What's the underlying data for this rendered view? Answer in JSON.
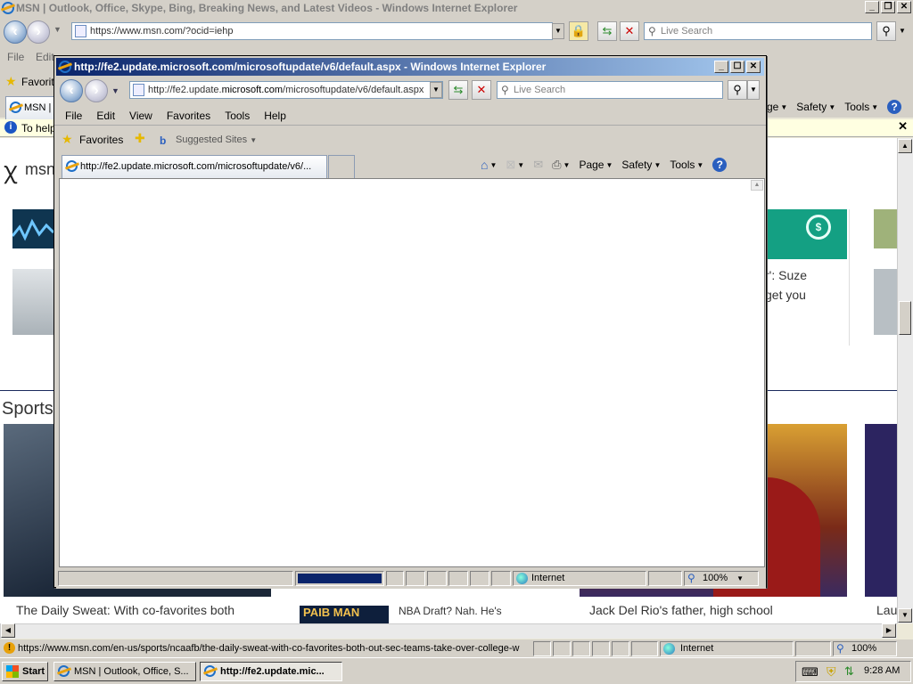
{
  "main_window": {
    "title": "MSN | Outlook, Office, Skype, Bing, Breaking News, and Latest Videos - Windows Internet Explorer",
    "address": "https://www.msn.com/?ocid=iehp",
    "search_placeholder": "Live Search",
    "menu": [
      "File",
      "Edit"
    ],
    "favorites_label": "Favorite",
    "tab_label": "MSN | C",
    "cmd_items": [
      "ge",
      "Safety",
      "Tools"
    ],
    "info_bar_text": "To help",
    "logo_text": "msn",
    "sports_heading": "Sports",
    "headlines": {
      "right_snippet_1": "r': Suze",
      "right_snippet_2": "get you",
      "sports_1": "The Daily Sweat: With co-favorites both",
      "sports_2": "NBA Draft? Nah. He's",
      "sports_2_img_text": "PAIB MAN",
      "sports_3": "Jack Del Rio's father, high school",
      "sports_4": "Lau"
    },
    "status_url": "https://www.msn.com/en-us/sports/ncaafb/the-daily-sweat-with-co-favorites-both-out-sec-teams-take-over-college-w",
    "status_zone": "Internet",
    "status_zoom": "100%"
  },
  "popup_window": {
    "title": "http://fe2.update.microsoft.com/microsoftupdate/v6/default.aspx - Windows Internet Explorer",
    "address_pre": "http://fe2.update.",
    "address_bold": "microsoft.com",
    "address_post": "/microsoftupdate/v6/default.aspx",
    "search_placeholder": "Live Search",
    "menu": [
      "File",
      "Edit",
      "View",
      "Favorites",
      "Tools",
      "Help"
    ],
    "favorites_label": "Favorites",
    "suggested_sites": "Suggested Sites",
    "tab_label": "http://fe2.update.microsoft.com/microsoftupdate/v6/...",
    "cmd_items": [
      "Page",
      "Safety",
      "Tools"
    ],
    "status_zone": "Internet",
    "status_zoom": "100%",
    "progress": 1
  },
  "taskbar": {
    "start_label": "Start",
    "tasks": [
      "MSN | Outlook, Office, S...",
      "http://fe2.update.mic..."
    ],
    "time": "9:28 AM"
  },
  "icons": [
    "ie-icon",
    "back-arrow-icon",
    "forward-arrow-icon",
    "lock-icon",
    "refresh-icon",
    "stop-icon",
    "search-icon",
    "star-icon",
    "home-icon",
    "rss-icon",
    "mail-icon",
    "print-icon",
    "help-icon",
    "globe-icon",
    "shield-icon",
    "zoom-icon",
    "close-icon",
    "windows-flag-icon"
  ]
}
